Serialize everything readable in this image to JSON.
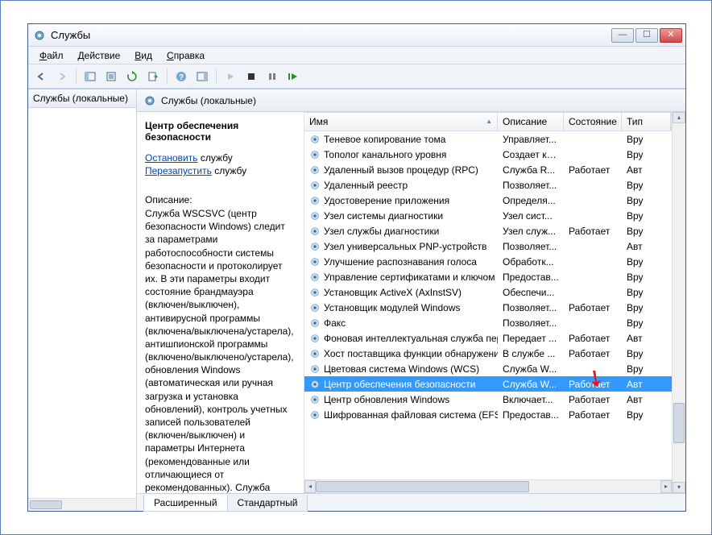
{
  "window": {
    "title": "Службы"
  },
  "menu": {
    "file": "Файл",
    "action": "Действие",
    "view": "Вид",
    "help": "Справка"
  },
  "leftpane": {
    "header": "Службы (локальные)"
  },
  "rp": {
    "header": "Службы (локальные)"
  },
  "detail": {
    "service_name": "Центр обеспечения безопасности",
    "link_stop": "Остановить",
    "link_stop_suffix": " службу",
    "link_restart": "Перезапустить",
    "link_restart_suffix": " службу",
    "desc_label": "Описание:",
    "desc_text": "Служба WSCSVC (центр безопасности Windows) следит за параметрами работоспособности системы безопасности и протоколирует их. В эти параметры входит состояние брандмауэра (включен/выключен), антивирусной программы (включена/выключена/устарела), антишпионской программы (включено/выключено/устарела), обновления Windows (автоматическая или ручная загрузка и установка обновлений), контроль учетных записей пользователей (включен/выключен) и параметры Интернета (рекомендованные или отличающиеся от рекомендованных). Служба"
  },
  "columns": {
    "name": "Имя",
    "description": "Описание",
    "status": "Состояние",
    "type": "Тип"
  },
  "rows": [
    {
      "name": "Теневое копирование тома",
      "desc": "Управляет...",
      "status": "",
      "type": "Вру"
    },
    {
      "name": "Тополог канального уровня",
      "desc": "Создает ка...",
      "status": "",
      "type": "Вру"
    },
    {
      "name": "Удаленный вызов процедур (RPC)",
      "desc": "Служба R...",
      "status": "Работает",
      "type": "Авт"
    },
    {
      "name": "Удаленный реестр",
      "desc": "Позволяет...",
      "status": "",
      "type": "Вру"
    },
    {
      "name": "Удостоверение приложения",
      "desc": "Определя...",
      "status": "",
      "type": "Вру"
    },
    {
      "name": "Узел системы диагностики",
      "desc": "Узел сист...",
      "status": "",
      "type": "Вру"
    },
    {
      "name": "Узел службы диагностики",
      "desc": "Узел служ...",
      "status": "Работает",
      "type": "Вру"
    },
    {
      "name": "Узел универсальных PNP-устройств",
      "desc": "Позволяет...",
      "status": "",
      "type": "Авт"
    },
    {
      "name": "Улучшение распознавания голоса",
      "desc": "Обработк...",
      "status": "",
      "type": "Вру"
    },
    {
      "name": "Управление сертификатами и ключом ...",
      "desc": "Предостав...",
      "status": "",
      "type": "Вру"
    },
    {
      "name": "Установщик ActiveX (AxInstSV)",
      "desc": "Обеспечи...",
      "status": "",
      "type": "Вру"
    },
    {
      "name": "Установщик модулей Windows",
      "desc": "Позволяет...",
      "status": "Работает",
      "type": "Вру"
    },
    {
      "name": "Факс",
      "desc": "Позволяет...",
      "status": "",
      "type": "Вру"
    },
    {
      "name": "Фоновая интеллектуальная служба пер...",
      "desc": "Передает ...",
      "status": "Работает",
      "type": "Авт"
    },
    {
      "name": "Хост поставщика функции обнаружения",
      "desc": "В службе ...",
      "status": "Работает",
      "type": "Вру"
    },
    {
      "name": "Цветовая система Windows (WCS)",
      "desc": "Служба W...",
      "status": "",
      "type": "Вру"
    },
    {
      "name": "Центр обеспечения безопасности",
      "desc": "Служба W...",
      "status": "Работает",
      "type": "Авт",
      "selected": true
    },
    {
      "name": "Центр обновления Windows",
      "desc": "Включает...",
      "status": "Работает",
      "type": "Авт"
    },
    {
      "name": "Шифрованная файловая система (EFS)",
      "desc": "Предостав...",
      "status": "Работает",
      "type": "Вру"
    }
  ],
  "tabs": {
    "extended": "Расширенный",
    "standard": "Стандартный"
  },
  "colw": {
    "name": 240,
    "desc": 82,
    "status": 72,
    "type": 36
  }
}
